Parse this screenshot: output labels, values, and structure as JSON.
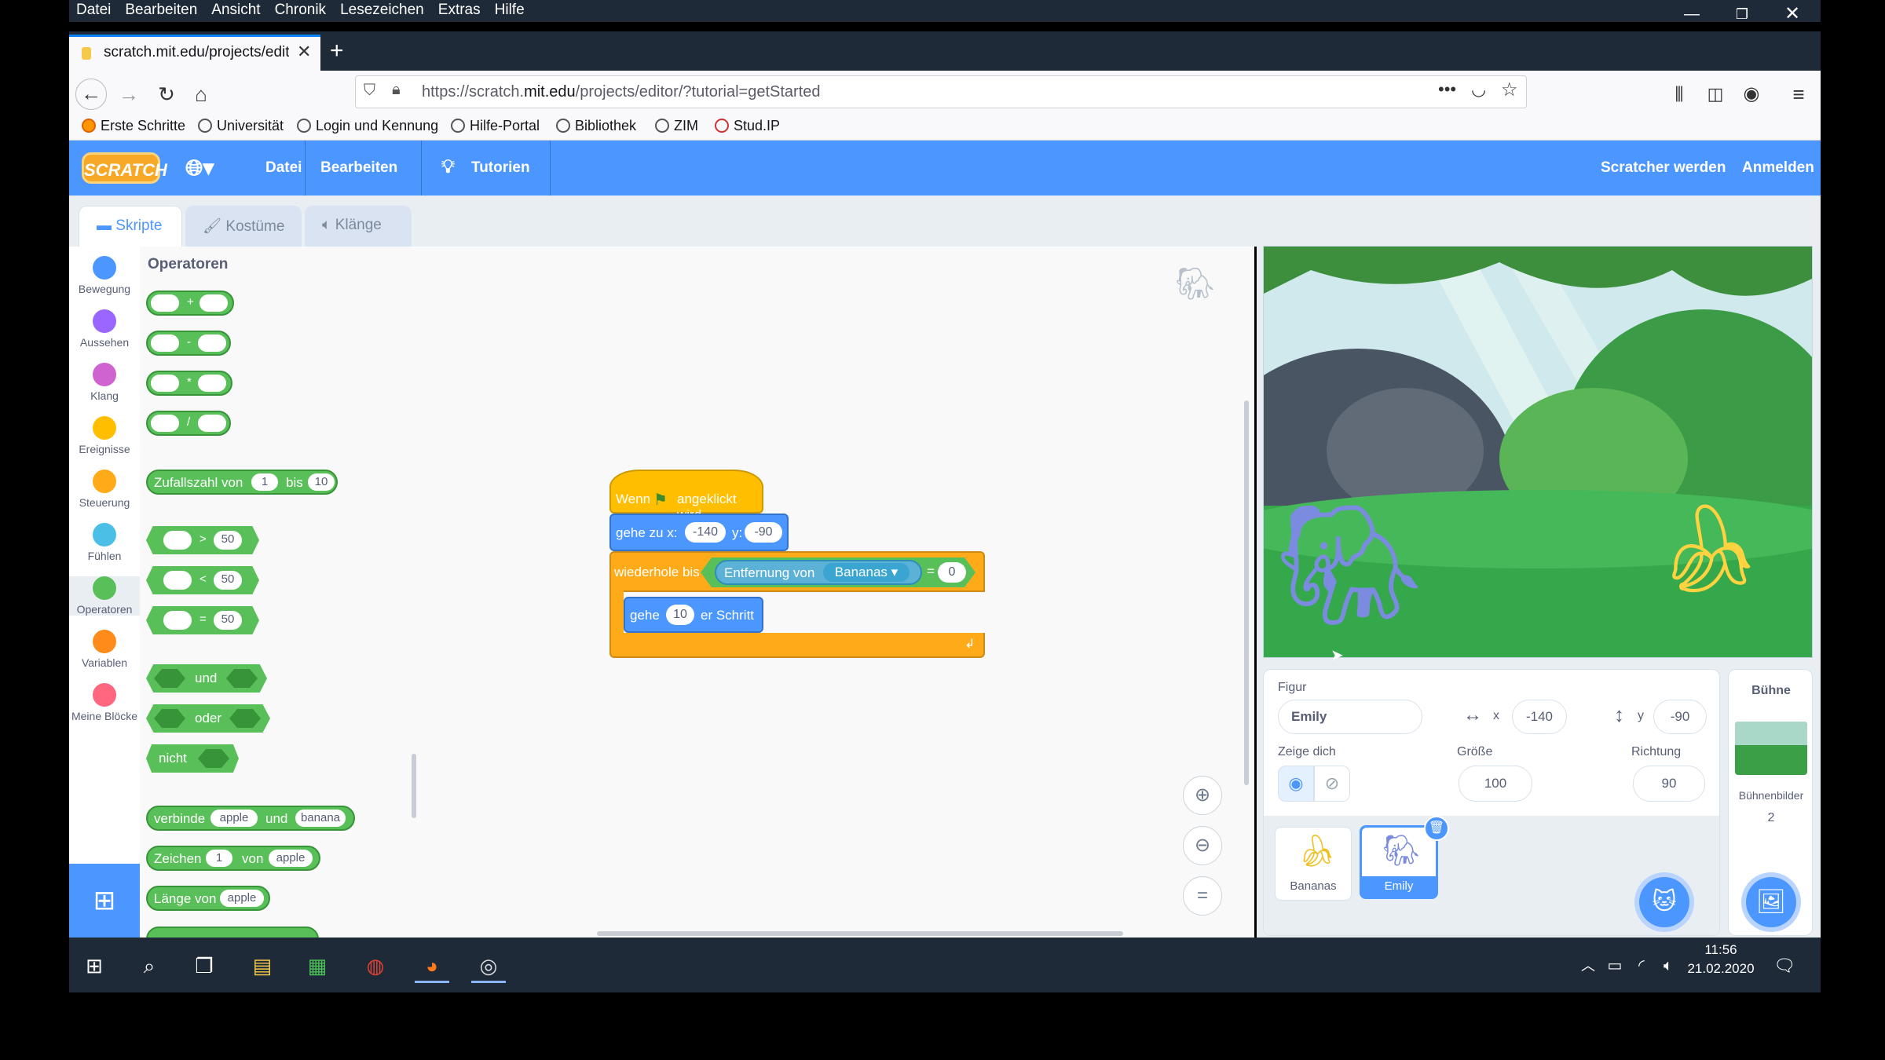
{
  "browser": {
    "menu": [
      "Datei",
      "Bearbeiten",
      "Ansicht",
      "Chronik",
      "Lesezeichen",
      "Extras",
      "Hilfe"
    ],
    "tab_title": "scratch.mit.edu/projects/editor",
    "url_prefix": "https://scratch.",
    "url_domain": "mit.edu",
    "url_suffix": "/projects/editor/?tutorial=getStarted",
    "bookmarks": [
      "Erste Schritte",
      "Universität",
      "Login und Kennung",
      "Hilfe-Portal",
      "Bibliothek",
      "ZIM",
      "Stud.IP"
    ]
  },
  "scratch": {
    "logo": "SCRATCH",
    "menu_file": "Datei",
    "menu_edit": "Bearbeiten",
    "menu_tutorials": "Tutorien",
    "join": "Scratcher werden",
    "signin": "Anmelden",
    "tabs": [
      "Skripte",
      "Kostüme",
      "Klänge"
    ],
    "categories": [
      {
        "label": "Bewegung",
        "color": "#4c97ff"
      },
      {
        "label": "Aussehen",
        "color": "#9966ff"
      },
      {
        "label": "Klang",
        "color": "#cf63cf"
      },
      {
        "label": "Ereignisse",
        "color": "#ffbf00"
      },
      {
        "label": "Steuerung",
        "color": "#ffab19"
      },
      {
        "label": "Fühlen",
        "color": "#4cbfe6"
      },
      {
        "label": "Operatoren",
        "color": "#59c059"
      },
      {
        "label": "Variablen",
        "color": "#ff8c1a"
      },
      {
        "label": "Meine Blöcke",
        "color": "#ff6680"
      }
    ],
    "palette": {
      "heading": "Operatoren",
      "ops": [
        "+",
        "-",
        "*",
        "/"
      ],
      "random": {
        "label": "Zufallszahl von",
        "a": "1",
        "mid": "bis",
        "b": "10"
      },
      "compare": [
        {
          "op": ">",
          "v": "50"
        },
        {
          "op": "<",
          "v": "50"
        },
        {
          "op": "=",
          "v": "50"
        }
      ],
      "logic": [
        "und",
        "oder",
        "nicht"
      ],
      "join": {
        "label": "verbinde",
        "a": "apple",
        "mid": "und",
        "b": "banana"
      },
      "letter": {
        "label": "Zeichen",
        "a": "1",
        "mid": "von",
        "b": "apple"
      },
      "length": {
        "label": "Länge von",
        "a": "apple"
      }
    },
    "script": {
      "hat_pre": "Wenn",
      "hat_post": "angeklickt wird",
      "goto_label": "gehe zu x:",
      "goto_x": "-140",
      "goto_ylabel": "y:",
      "goto_y": "-90",
      "repeat_label": "wiederhole bis",
      "distance_label": "Entfernung von",
      "distance_target": "Bananas",
      "equals": "=",
      "equals_value": "0",
      "move_label": "gehe",
      "move_value": "10",
      "move_post": "er Schritt"
    },
    "sprite_info": {
      "figure_label": "Figur",
      "name": "Emily",
      "x_label": "x",
      "x": "-140",
      "y_label": "y",
      "y": "-90",
      "show_label": "Zeige dich",
      "size_label": "Größe",
      "size": "100",
      "direction_label": "Richtung",
      "direction": "90"
    },
    "sprites": [
      {
        "name": "Bananas"
      },
      {
        "name": "Emily"
      }
    ],
    "stage_pane": {
      "title": "Bühne",
      "backdrops_label": "Bühnenbilder",
      "backdrops_count": "2"
    }
  },
  "taskbar": {
    "time": "11:56",
    "date": "21.02.2020"
  }
}
